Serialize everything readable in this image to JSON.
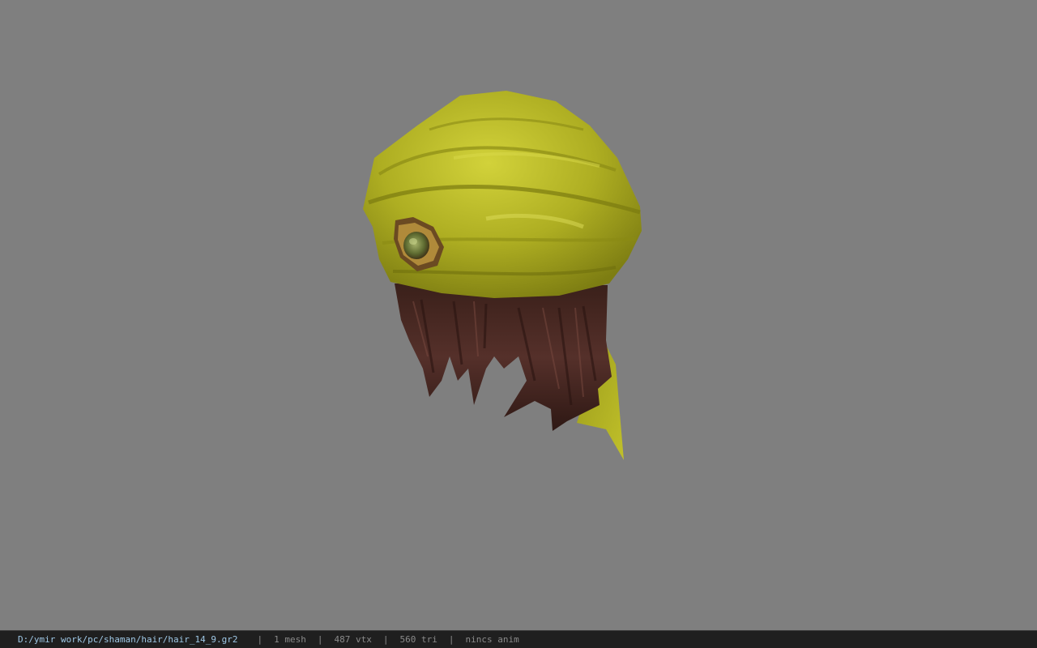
{
  "viewer": {
    "background_color": "#7f7f7f",
    "model": {
      "icon": "hair-model-icon",
      "headwrap_color": "#b5b523",
      "hair_color": "#4a2a22",
      "gem_color": "#7f8a3a"
    }
  },
  "status_bar": {
    "file_path": "D:/ymir work/pc/shaman/hair/hair_14_9.gr2",
    "separator": "|",
    "mesh_count": "1 mesh",
    "vertex_count": "487 vtx",
    "triangle_count": "560 tri",
    "anim_status": "nincs anim"
  }
}
